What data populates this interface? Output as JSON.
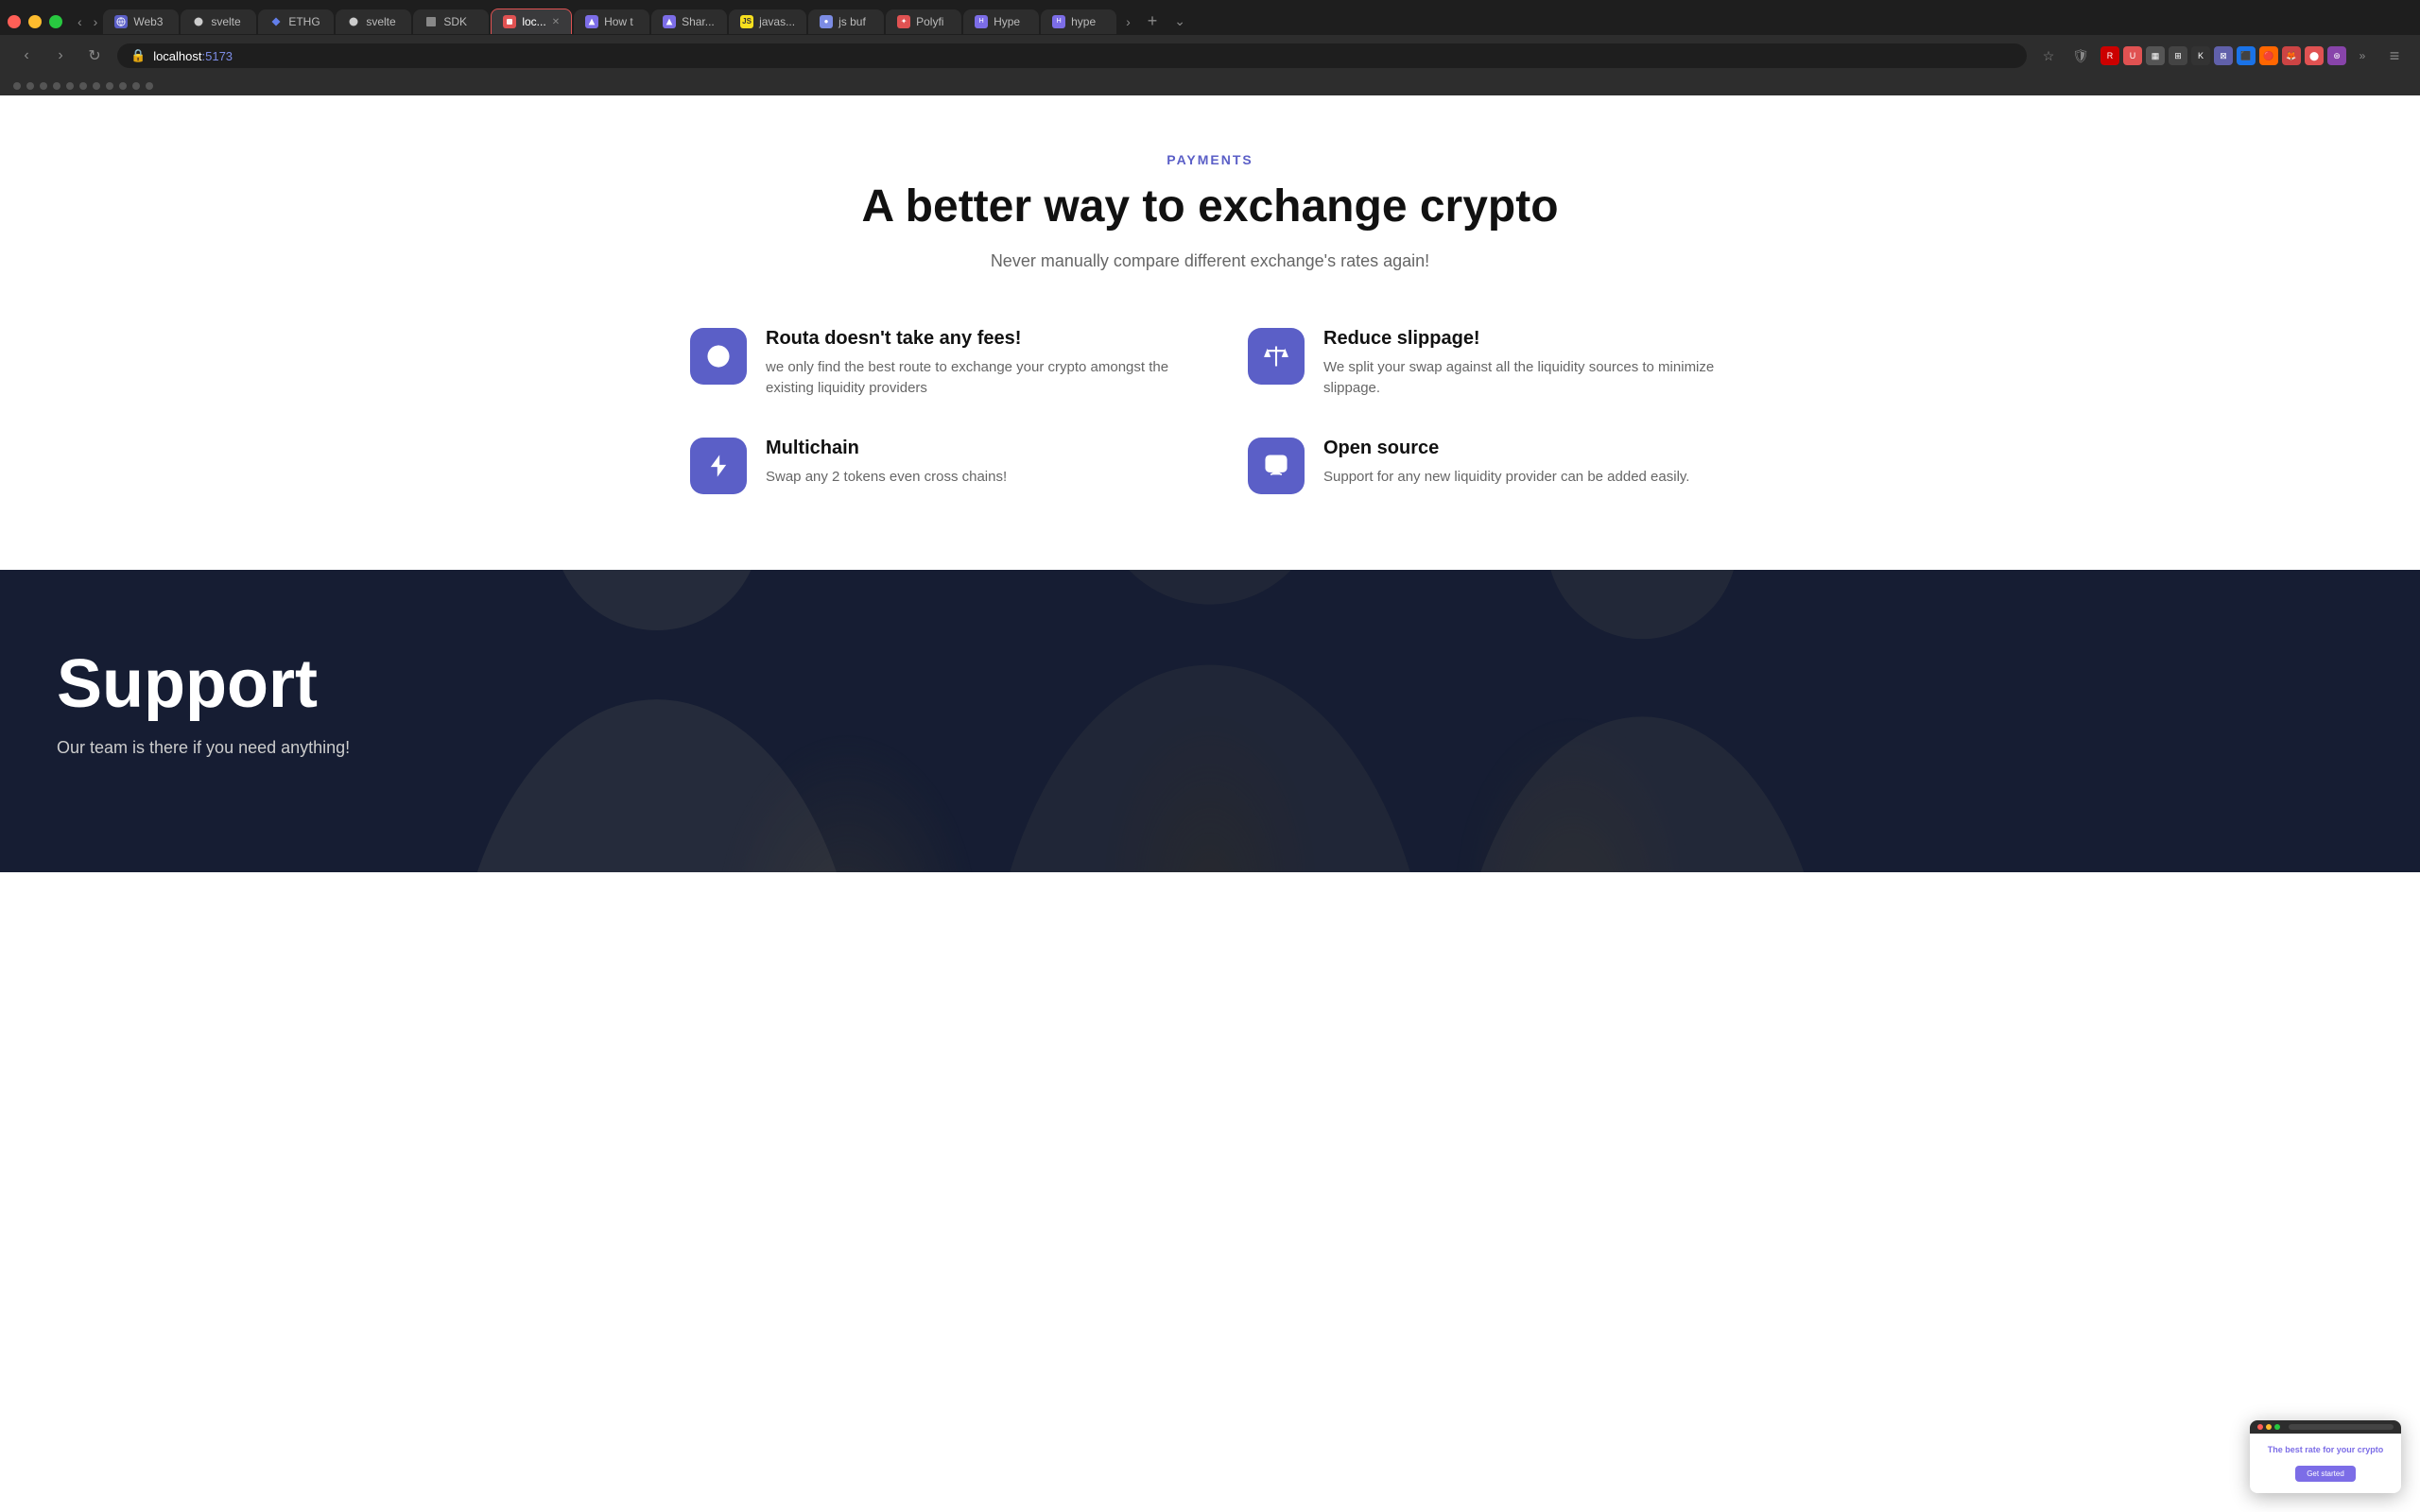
{
  "browser": {
    "traffic_lights": [
      "red",
      "yellow",
      "green"
    ],
    "url": {
      "host": "localhost",
      "port": ":5173"
    },
    "tabs": [
      {
        "id": "web3",
        "label": "Web3",
        "favicon_color": "#5b5fc7",
        "active": false,
        "closable": false
      },
      {
        "id": "svelte1",
        "label": "svelte",
        "favicon_color": "#ccc",
        "active": false,
        "closable": false
      },
      {
        "id": "ethg",
        "label": "ETHG",
        "favicon_color": "#627eea",
        "active": false,
        "closable": false
      },
      {
        "id": "svelte2",
        "label": "svelte",
        "favicon_color": "#ccc",
        "active": false,
        "closable": false
      },
      {
        "id": "sdk",
        "label": "SDK",
        "favicon_color": "#888",
        "active": false,
        "closable": false
      },
      {
        "id": "localhost",
        "label": "loc...",
        "favicon_color": "#e05252",
        "active": true,
        "closable": true
      },
      {
        "id": "how",
        "label": "How t",
        "favicon_color": "#7c6de7",
        "active": false,
        "closable": false
      },
      {
        "id": "shared",
        "label": "Shar...",
        "favicon_color": "#7c6de7",
        "active": false,
        "closable": false
      },
      {
        "id": "javascript",
        "label": "javas...",
        "favicon_color": "#f7df1e",
        "active": false,
        "closable": false
      },
      {
        "id": "jsbuf",
        "label": "js buf",
        "favicon_color": "#7c8ce4",
        "active": false,
        "closable": false
      },
      {
        "id": "polyfill",
        "label": "Polyfi",
        "favicon_color": "#e05252",
        "active": false,
        "closable": false
      },
      {
        "id": "hype1",
        "label": "Hype",
        "favicon_color": "#7c6de7",
        "active": false,
        "closable": false
      },
      {
        "id": "hype2",
        "label": "hype",
        "favicon_color": "#7c6de7",
        "active": false,
        "closable": false
      }
    ]
  },
  "page": {
    "payments": {
      "section_label": "PAYMENTS",
      "title": "A better way to exchange crypto",
      "subtitle": "Never manually compare different exchange's rates again!",
      "features": [
        {
          "id": "no-fees",
          "icon": "globe",
          "title": "Routa doesn't take any fees!",
          "description": "we only find the best route to exchange your crypto amongst the existing liquidity providers"
        },
        {
          "id": "reduce-slippage",
          "icon": "balance",
          "title": "Reduce slippage!",
          "description": "We split your swap against all the liquidity sources to minimize slippage."
        },
        {
          "id": "multichain",
          "icon": "lightning",
          "title": "Multichain",
          "description": "Swap any 2 tokens even cross chains!"
        },
        {
          "id": "open-source",
          "icon": "chat",
          "title": "Open source",
          "description": "Support for any new liquidity provider can be added easily."
        }
      ]
    },
    "support": {
      "title": "Support",
      "subtitle": "Our team is there if you need anything!"
    }
  },
  "preview_card": {
    "title_before": "The best rate for ",
    "title_highlight": "your crypto",
    "button_label": "Get started"
  }
}
